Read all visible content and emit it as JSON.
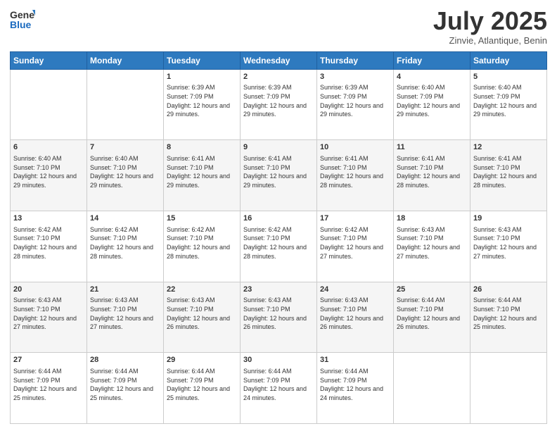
{
  "logo": {
    "general": "General",
    "blue": "Blue"
  },
  "header": {
    "month": "July 2025",
    "location": "Zinvie, Atlantique, Benin"
  },
  "days_of_week": [
    "Sunday",
    "Monday",
    "Tuesday",
    "Wednesday",
    "Thursday",
    "Friday",
    "Saturday"
  ],
  "weeks": [
    [
      {
        "day": "",
        "sunrise": "",
        "sunset": "",
        "daylight": ""
      },
      {
        "day": "",
        "sunrise": "",
        "sunset": "",
        "daylight": ""
      },
      {
        "day": "1",
        "sunrise": "Sunrise: 6:39 AM",
        "sunset": "Sunset: 7:09 PM",
        "daylight": "Daylight: 12 hours and 29 minutes."
      },
      {
        "day": "2",
        "sunrise": "Sunrise: 6:39 AM",
        "sunset": "Sunset: 7:09 PM",
        "daylight": "Daylight: 12 hours and 29 minutes."
      },
      {
        "day": "3",
        "sunrise": "Sunrise: 6:39 AM",
        "sunset": "Sunset: 7:09 PM",
        "daylight": "Daylight: 12 hours and 29 minutes."
      },
      {
        "day": "4",
        "sunrise": "Sunrise: 6:40 AM",
        "sunset": "Sunset: 7:09 PM",
        "daylight": "Daylight: 12 hours and 29 minutes."
      },
      {
        "day": "5",
        "sunrise": "Sunrise: 6:40 AM",
        "sunset": "Sunset: 7:09 PM",
        "daylight": "Daylight: 12 hours and 29 minutes."
      }
    ],
    [
      {
        "day": "6",
        "sunrise": "Sunrise: 6:40 AM",
        "sunset": "Sunset: 7:10 PM",
        "daylight": "Daylight: 12 hours and 29 minutes."
      },
      {
        "day": "7",
        "sunrise": "Sunrise: 6:40 AM",
        "sunset": "Sunset: 7:10 PM",
        "daylight": "Daylight: 12 hours and 29 minutes."
      },
      {
        "day": "8",
        "sunrise": "Sunrise: 6:41 AM",
        "sunset": "Sunset: 7:10 PM",
        "daylight": "Daylight: 12 hours and 29 minutes."
      },
      {
        "day": "9",
        "sunrise": "Sunrise: 6:41 AM",
        "sunset": "Sunset: 7:10 PM",
        "daylight": "Daylight: 12 hours and 29 minutes."
      },
      {
        "day": "10",
        "sunrise": "Sunrise: 6:41 AM",
        "sunset": "Sunset: 7:10 PM",
        "daylight": "Daylight: 12 hours and 28 minutes."
      },
      {
        "day": "11",
        "sunrise": "Sunrise: 6:41 AM",
        "sunset": "Sunset: 7:10 PM",
        "daylight": "Daylight: 12 hours and 28 minutes."
      },
      {
        "day": "12",
        "sunrise": "Sunrise: 6:41 AM",
        "sunset": "Sunset: 7:10 PM",
        "daylight": "Daylight: 12 hours and 28 minutes."
      }
    ],
    [
      {
        "day": "13",
        "sunrise": "Sunrise: 6:42 AM",
        "sunset": "Sunset: 7:10 PM",
        "daylight": "Daylight: 12 hours and 28 minutes."
      },
      {
        "day": "14",
        "sunrise": "Sunrise: 6:42 AM",
        "sunset": "Sunset: 7:10 PM",
        "daylight": "Daylight: 12 hours and 28 minutes."
      },
      {
        "day": "15",
        "sunrise": "Sunrise: 6:42 AM",
        "sunset": "Sunset: 7:10 PM",
        "daylight": "Daylight: 12 hours and 28 minutes."
      },
      {
        "day": "16",
        "sunrise": "Sunrise: 6:42 AM",
        "sunset": "Sunset: 7:10 PM",
        "daylight": "Daylight: 12 hours and 28 minutes."
      },
      {
        "day": "17",
        "sunrise": "Sunrise: 6:42 AM",
        "sunset": "Sunset: 7:10 PM",
        "daylight": "Daylight: 12 hours and 27 minutes."
      },
      {
        "day": "18",
        "sunrise": "Sunrise: 6:43 AM",
        "sunset": "Sunset: 7:10 PM",
        "daylight": "Daylight: 12 hours and 27 minutes."
      },
      {
        "day": "19",
        "sunrise": "Sunrise: 6:43 AM",
        "sunset": "Sunset: 7:10 PM",
        "daylight": "Daylight: 12 hours and 27 minutes."
      }
    ],
    [
      {
        "day": "20",
        "sunrise": "Sunrise: 6:43 AM",
        "sunset": "Sunset: 7:10 PM",
        "daylight": "Daylight: 12 hours and 27 minutes."
      },
      {
        "day": "21",
        "sunrise": "Sunrise: 6:43 AM",
        "sunset": "Sunset: 7:10 PM",
        "daylight": "Daylight: 12 hours and 27 minutes."
      },
      {
        "day": "22",
        "sunrise": "Sunrise: 6:43 AM",
        "sunset": "Sunset: 7:10 PM",
        "daylight": "Daylight: 12 hours and 26 minutes."
      },
      {
        "day": "23",
        "sunrise": "Sunrise: 6:43 AM",
        "sunset": "Sunset: 7:10 PM",
        "daylight": "Daylight: 12 hours and 26 minutes."
      },
      {
        "day": "24",
        "sunrise": "Sunrise: 6:43 AM",
        "sunset": "Sunset: 7:10 PM",
        "daylight": "Daylight: 12 hours and 26 minutes."
      },
      {
        "day": "25",
        "sunrise": "Sunrise: 6:44 AM",
        "sunset": "Sunset: 7:10 PM",
        "daylight": "Daylight: 12 hours and 26 minutes."
      },
      {
        "day": "26",
        "sunrise": "Sunrise: 6:44 AM",
        "sunset": "Sunset: 7:10 PM",
        "daylight": "Daylight: 12 hours and 25 minutes."
      }
    ],
    [
      {
        "day": "27",
        "sunrise": "Sunrise: 6:44 AM",
        "sunset": "Sunset: 7:09 PM",
        "daylight": "Daylight: 12 hours and 25 minutes."
      },
      {
        "day": "28",
        "sunrise": "Sunrise: 6:44 AM",
        "sunset": "Sunset: 7:09 PM",
        "daylight": "Daylight: 12 hours and 25 minutes."
      },
      {
        "day": "29",
        "sunrise": "Sunrise: 6:44 AM",
        "sunset": "Sunset: 7:09 PM",
        "daylight": "Daylight: 12 hours and 25 minutes."
      },
      {
        "day": "30",
        "sunrise": "Sunrise: 6:44 AM",
        "sunset": "Sunset: 7:09 PM",
        "daylight": "Daylight: 12 hours and 24 minutes."
      },
      {
        "day": "31",
        "sunrise": "Sunrise: 6:44 AM",
        "sunset": "Sunset: 7:09 PM",
        "daylight": "Daylight: 12 hours and 24 minutes."
      },
      {
        "day": "",
        "sunrise": "",
        "sunset": "",
        "daylight": ""
      },
      {
        "day": "",
        "sunrise": "",
        "sunset": "",
        "daylight": ""
      }
    ]
  ]
}
